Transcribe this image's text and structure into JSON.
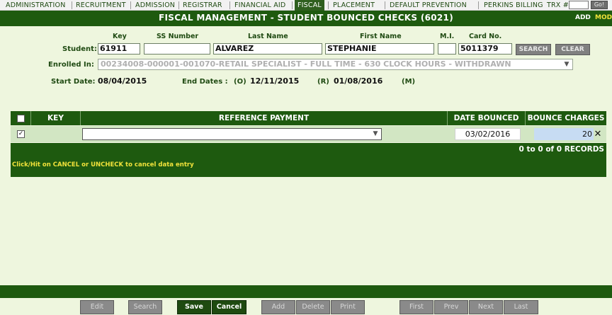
{
  "nav": {
    "tabs": [
      "ADMINISTRATION",
      "RECRUITMENT",
      "ADMISSION",
      "REGISTRAR",
      "FINANCIAL AID",
      "FISCAL",
      "PLACEMENT",
      "DEFAULT PREVENTION",
      "PERKINS BILLING"
    ],
    "active_tab": "FISCAL",
    "trx_label": "TRX #:",
    "trx_value": "",
    "go_label": "Go!"
  },
  "header": {
    "title": "FISCAL MANAGEMENT - STUDENT BOUNCED CHECKS (6021)",
    "add_label": "ADD",
    "mod_label": "MOD"
  },
  "student": {
    "label": "Student:",
    "headers": {
      "key": "Key",
      "ssn": "SS Number",
      "last": "Last Name",
      "first": "First Name",
      "mi": "M.I.",
      "card": "Card No."
    },
    "key": "61911",
    "ssn": "",
    "last_name": "ALVAREZ",
    "first_name": "STEPHANIE",
    "mi": "",
    "card_no": "5011379",
    "search_label": "SEARCH",
    "clear_label": "CLEAR"
  },
  "enrollment": {
    "label": "Enrolled In:",
    "value": "00234008-000001-001070-RETAIL SPECIALIST - FULL TIME - 630 CLOCK HOURS - WITHDRAWN"
  },
  "dates": {
    "start_label": "Start Date:",
    "start_value": "08/04/2015",
    "end_label": "End Dates :",
    "o_label": "(O)",
    "o_value": "12/11/2015",
    "r_label": "(R)",
    "r_value": "01/08/2016",
    "m_label": "(M)"
  },
  "grid": {
    "columns": [
      "KEY",
      "REFERENCE PAYMENT",
      "DATE BOUNCED",
      "BOUNCE CHARGES"
    ],
    "row": {
      "checked": true,
      "key": "",
      "reference_payment": "",
      "date_bounced": "03/02/2016",
      "bounce_charges": "20"
    },
    "records_text": "0 to 0 of 0 RECORDS",
    "cancel_note": "Click/Hit on CANCEL or UNCHECK to cancel data entry"
  },
  "footer": {
    "buttons": [
      "Edit",
      "Search",
      "Save",
      "Cancel",
      "Add",
      "Delete",
      "Print",
      "First",
      "Prev",
      "Next",
      "Last"
    ]
  }
}
